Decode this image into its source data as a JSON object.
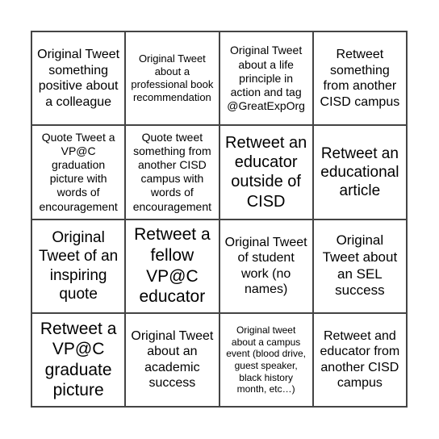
{
  "cells": [
    "Original Tweet something positive about a colleague",
    "Original Tweet about a professional book recommendation",
    "Original Tweet about a life principle in action and tag @GreatExpOrg",
    "Retweet something from another CISD campus",
    "Quote Tweet a VP@C graduation picture with words of encouragement",
    "Quote tweet something from another CISD campus with words of encouragement",
    "Retweet an educator outside of CISD",
    "Retweet an educational article",
    "Original Tweet of an inspiring quote",
    "Retweet a fellow VP@C educator",
    "Original Tweet of student work (no names)",
    "Original Tweet about an SEL success",
    "Retweet a VP@C graduate picture",
    "Original Tweet about an academic success",
    "Original tweet about a campus event (blood drive, guest speaker, black history month, etc…)",
    "Retweet and educator from another CISD campus"
  ]
}
